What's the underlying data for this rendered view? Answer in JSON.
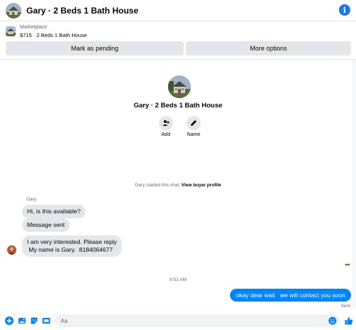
{
  "header": {
    "title": "Gary · 2 Beds 1 Bath House",
    "info_icon": "info-icon"
  },
  "marketplace": {
    "label": "Marketplace",
    "listing": "$715 · 2 Beds 1 Bath House"
  },
  "actions": {
    "mark_pending": "Mark as pending",
    "more_options": "More options"
  },
  "profile": {
    "name": "Gary · 2 Beds 1 Bath House",
    "add_label": "Add",
    "name_label": "Name"
  },
  "system": {
    "started": "Gary started this chat.",
    "view_profile": "View buyer profile"
  },
  "messages": {
    "sender": "Gary",
    "m1": "Hi, is this available?",
    "m2": "Message sent",
    "m3_line1": "I am very interested.  Please reply",
    "m3_line2": " My name is Gary.  8184064677",
    "timestamp": "9:52 AM",
    "outgoing": "okay dear wait   we will contact you soon",
    "status": "Sent"
  },
  "composer": {
    "placeholder": "Aa"
  },
  "colors": {
    "accent": "#0084ff",
    "brand": "#1877f2",
    "bubble_incoming": "#e4e6eb"
  }
}
